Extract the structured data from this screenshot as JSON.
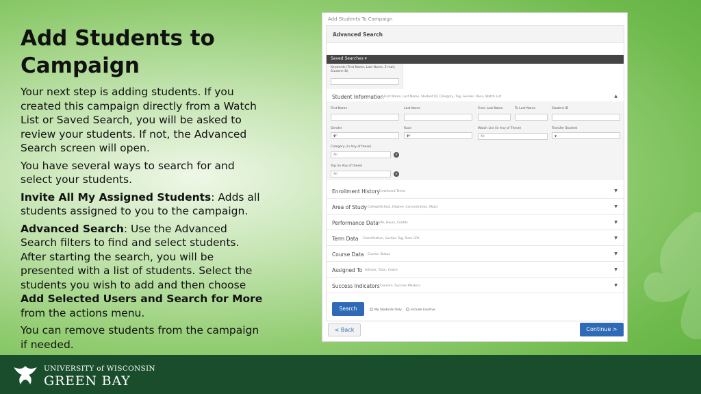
{
  "slide": {
    "title": "Add Students to Campaign",
    "paragraphs": {
      "p1": "Your next step is adding students. If you created this campaign directly from a Watch List or Saved Search, you will be asked to review your students. If not, the Advanced Search screen will open.",
      "p2": "You have several ways to search for and select your students.",
      "p3_bold": "Invite All My Assigned Students",
      "p3_rest": ": Adds all students assigned to you to the campaign.",
      "p4_bold": "Advanced Search",
      "p4_rest": ": Use the Advanced Search filters to find and select students. After starting the search, you will be presented with a list of students. Select the students you wish to add and then choose ",
      "p4_bold2": "Add Selected Users and Search for More",
      "p4_rest2": " from the actions menu.",
      "p5": "You can remove students from the campaign if needed."
    }
  },
  "footer": {
    "line1": "UNIVERSITY of WISCONSIN",
    "line2": "GREEN BAY"
  },
  "screenshot": {
    "window_title": "Add Students To Campaign",
    "advanced_search": "Advanced Search",
    "saved_searches": "Saved Searches ▾",
    "keywords_label": "Keywords (First Name, Last Name, E-mail, Student ID)",
    "student_info": {
      "heading": "Student Information",
      "sub": "First Name, Last Name, Student ID, Category, Tag, Gender, Race, Watch List",
      "first_name": "First Name",
      "last_name": "Last Name",
      "from_last_name": "From Last Name",
      "to_last_name": "To Last Name",
      "student_id": "Student ID",
      "gender": "Gender",
      "gender_value": "All",
      "race": "Race",
      "race_value": "All",
      "watch_list": "Watch List (in Any of These)",
      "watch_list_value": "All",
      "transfer_student": "Transfer Student",
      "category": "Category (in Any of these)",
      "category_value": "All",
      "tag": "Tag (in Any of these)",
      "tag_value": "All"
    },
    "sections": [
      {
        "title": "Enrollment History",
        "sub": "Enrollment Terms"
      },
      {
        "title": "Area of Study",
        "sub": "College/School, Degree, Concentration, Major"
      },
      {
        "title": "Performance Data",
        "sub": "GPA, Hours, Credits"
      },
      {
        "title": "Term Data",
        "sub": "Classification, Section Tag, Term GPA"
      },
      {
        "title": "Course Data",
        "sub": "Course, Status"
      },
      {
        "title": "Assigned To",
        "sub": "Advisor, Tutor, Coach"
      },
      {
        "title": "Success Indicators",
        "sub": "Concern, Success Markers"
      }
    ],
    "search_button": "Search",
    "my_students_only": "My Students Only",
    "include_inactive": "Include Inactive",
    "back_button": "< Back",
    "continue_button": "Continue >"
  }
}
